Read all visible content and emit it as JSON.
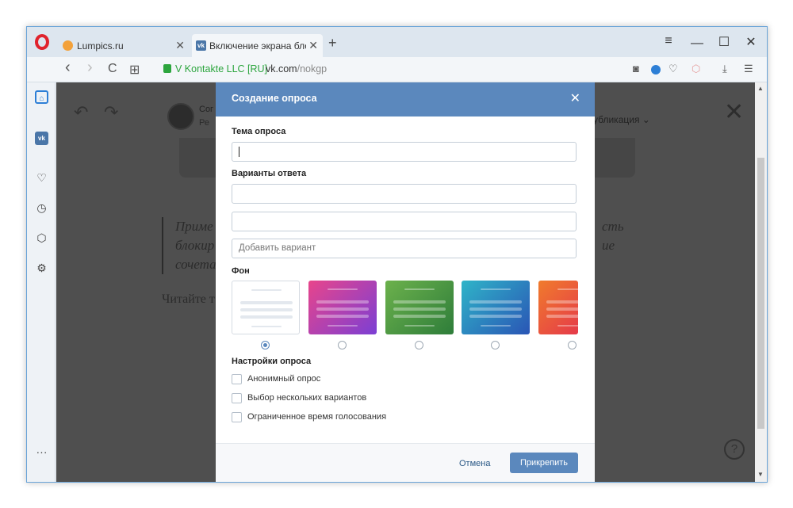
{
  "browser": {
    "tabs": [
      {
        "title": "Lumpics.ru",
        "close": "✕"
      },
      {
        "title": "Включение экрана блокир",
        "close": "✕"
      }
    ],
    "new_tab": "+",
    "window_controls": {
      "menu": "≡",
      "minimize": "—",
      "maximize": "☐",
      "close": "✕"
    },
    "nav": {
      "back": "‹",
      "forward": "›",
      "reload": "C",
      "tabs": "⊞"
    },
    "site_owner": "V Kontakte LLC [RU]",
    "url_host": "vk.com",
    "url_path": "/nokgp",
    "toolbar_icons": [
      "camera-icon",
      "shield-icon",
      "heart-icon",
      "cube-icon",
      "download-icon",
      "settings-icon"
    ],
    "sidebar_icons": [
      "home-icon",
      "vk-icon",
      "heart-icon",
      "clock-icon",
      "cube-icon",
      "gear-icon",
      "more-icon"
    ]
  },
  "background": {
    "author_name": "Сог",
    "author_sub": "Ре",
    "publish_label": "убликация ⌄",
    "quote_lines": [
      "Приме",
      "блокир",
      "сочета"
    ],
    "quote_right": [
      "сть",
      "ие"
    ],
    "read_also": "Читайте т",
    "close": "✕",
    "help": "?"
  },
  "modal": {
    "title": "Создание опроса",
    "close": "✕",
    "topic_label": "Тема опроса",
    "topic_value": "",
    "answers_label": "Варианты ответа",
    "answer_values": [
      "",
      ""
    ],
    "add_option_placeholder": "Добавить вариант",
    "background_label": "Фон",
    "backgrounds": [
      {
        "name": "white",
        "colors": [
          "#ffffff",
          "#ffffff"
        ],
        "selected": true
      },
      {
        "name": "pink-purple",
        "colors": [
          "#e8458b",
          "#7b3fd4"
        ],
        "selected": false
      },
      {
        "name": "green",
        "colors": [
          "#6cb14c",
          "#2e7d3a"
        ],
        "selected": false
      },
      {
        "name": "blue",
        "colors": [
          "#2fb4c8",
          "#2a55b5"
        ],
        "selected": false
      },
      {
        "name": "orange-red",
        "colors": [
          "#f07b2c",
          "#e53a4a"
        ],
        "selected": false
      }
    ],
    "settings_label": "Настройки опроса",
    "settings": [
      {
        "label": "Анонимный опрос",
        "checked": false
      },
      {
        "label": "Выбор нескольких вариантов",
        "checked": false
      },
      {
        "label": "Ограниченное время голосования",
        "checked": false
      }
    ],
    "cancel_label": "Отмена",
    "attach_label": "Прикрепить"
  },
  "colors": {
    "accent": "#5b88bd",
    "overlay": "#4f4f4f",
    "secure_green": "#2ca53e"
  }
}
